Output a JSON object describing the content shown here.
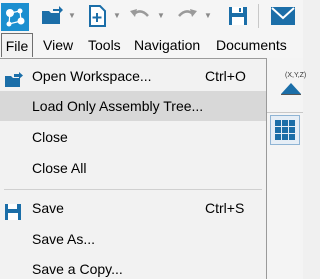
{
  "colors": {
    "accent": "#1b6ea8",
    "toolbar_bg": "#f5f5f5",
    "menu_bg": "#f2f2f2",
    "highlight": "#d8d8d8"
  },
  "toolbar": {
    "icons": [
      "app-logo-icon",
      "open-workspace-icon",
      "new-icon",
      "undo-icon",
      "redo-icon",
      "save-icon",
      "mail-icon"
    ]
  },
  "menubar": {
    "items": [
      "File",
      "View",
      "Tools",
      "Navigation",
      "Documents"
    ]
  },
  "file_menu": {
    "items": [
      {
        "label": "Open Workspace...",
        "shortcut": "Ctrl+O",
        "icon": "open-workspace-icon"
      },
      {
        "label": "Load Only Assembly Tree...",
        "shortcut": ""
      },
      {
        "label": "Close",
        "shortcut": ""
      },
      {
        "label": "Close All",
        "shortcut": ""
      },
      {
        "label": "Save",
        "shortcut": "Ctrl+S",
        "icon": "save-icon"
      },
      {
        "label": "Save As...",
        "shortcut": ""
      },
      {
        "label": "Save a Copy...",
        "shortcut": ""
      }
    ]
  },
  "ribbon_right": {
    "coord_label": "(X,Y,Z)"
  }
}
